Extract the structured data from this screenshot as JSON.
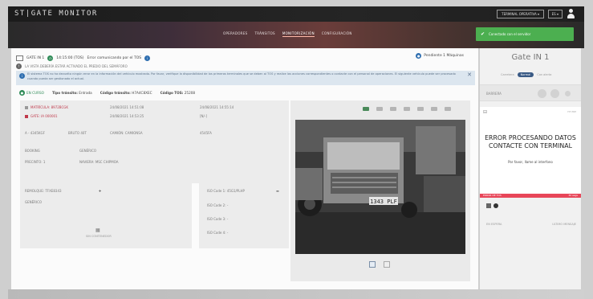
{
  "app": {
    "brand": "ST|GATE MONITOR",
    "terminal_select": "TERMINAL OPERATIVA ▾",
    "lang_select": "ES ▾"
  },
  "nav": {
    "items": [
      "OPERADORES",
      "TRÁNSITOS",
      "MONITORIZACIÓN",
      "CONFIGURACIÓN"
    ],
    "active_index": 2
  },
  "toast": {
    "text": "Conectado con el servidor"
  },
  "header": {
    "gate": "GATE IN 1",
    "time": "14:15:00 (TOS)",
    "tos_status": "Error comunicando por el TOS",
    "pending": "Pendiente 1 Máquinas"
  },
  "message_line": "LA VISTA DEBERÍA ESTAR ACTIVADO EL PREDIO DEL SEMÁFORO",
  "info_banner": "El sistema TOS no ha devuelto ningún error en la información del vehículo mostrado. Por favor, verifique la disponibilidad de los primeros terminales que se deben al TOS y realice las acciones correspondientes o contacte con el personal de operaciones. El siguiente vehículo puede ser procesado cuando pueda ser gestionado el actual.",
  "transit": {
    "status": "EN CURSO",
    "tipo_label": "Tipo tránsito:",
    "tipo_value": "Entrada",
    "codigo_label": "Código tránsito:",
    "codigo_value": "H7A4C8XEC",
    "tos_label": "Código TOS:",
    "tos_value": "25208"
  },
  "details": {
    "matricula": "MATRÍCULA: 8972BCGK",
    "gate": "GATE: IA 000001",
    "date1": "24/08/2021 14:51:08",
    "date2": "24/08/2021 14:53:25",
    "date3": "24/08/2021 14:55:14",
    "empty": "[N/-]",
    "tara": "A - 4345KGF",
    "peso": "BRUTO 40T",
    "camion": "CAMIÓN: CAMIONSA",
    "matricula2": "4545FA",
    "booking": "BOOKING",
    "generico": "GENÉRICO",
    "precinto": "PRECINTO: 1",
    "naviera": "NAVIERA: MSC CHIPMOA"
  },
  "chassis": {
    "label": "REMOLQUE: TFXE8343",
    "value": "GENÉRICO",
    "no_cont": "SIN CONTENEDOR"
  },
  "iso": [
    "ISO Code 1: 45G1/PLHP",
    "ISO Code 2: -",
    "ISO Code 3: -",
    "ISO Code 4: -"
  ],
  "sidebar": {
    "title": "Gate IN 1",
    "sub_left": "Carretera",
    "sub_pill": "Normal",
    "sub_right": "Con alerta",
    "barrier_label": "BARRERA",
    "err_line1": "ERROR PROCESANDO DATOS",
    "err_line2": "CONTACTE CON TERMINAL",
    "err_sub": "Por favor, llame al interfono",
    "err_tr": "HH:MM",
    "red_left": "ERROR DE TOS",
    "red_right": "30 segs",
    "bottom_left": "EN ESPERA",
    "bottom_right": "ULTIMO MENSAJE"
  },
  "camera": {
    "plate": "1343 PLF"
  },
  "colors": {
    "accent_green": "#4caf50",
    "status_green": "#2e8b57",
    "error_red": "#e84659",
    "info_bg": "#dce6ef",
    "nav_gradient_mid": "#6a3d3a"
  }
}
